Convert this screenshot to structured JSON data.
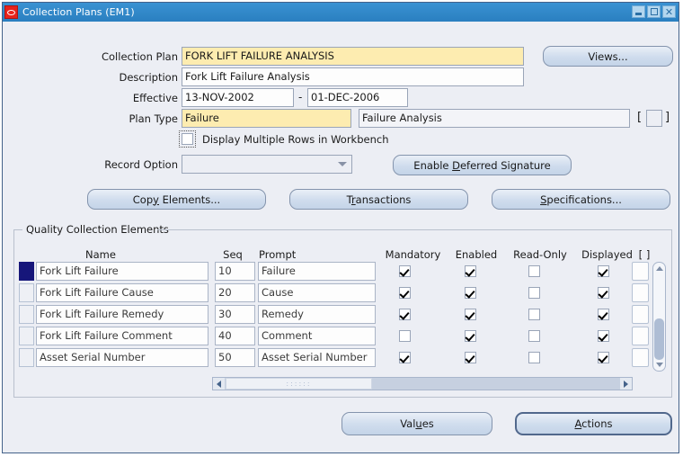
{
  "window": {
    "title": "Collection Plans (EM1)",
    "icon": "oracle-logo-icon",
    "minimize_label": "",
    "maximize_label": "",
    "close_label": "✕",
    "titlebar_color": "#2f86c8"
  },
  "form": {
    "labels": {
      "collection_plan": "Collection Plan",
      "description": "Description",
      "effective": "Effective",
      "plan_type": "Plan Type",
      "record_option": "Record Option"
    },
    "collection_plan": "FORK LIFT FAILURE ANALYSIS",
    "description": "Fork Lift Failure Analysis",
    "effective_from": "13-NOV-2002",
    "effective_dash": "-",
    "effective_to": "01-DEC-2006",
    "plan_type_code": "Failure",
    "plan_type_desc": "Failure Analysis",
    "bracket_open": "[",
    "bracket_close": "]",
    "display_multiple_rows_label": "Display Multiple Rows in Workbench",
    "display_multiple_rows_checked": false,
    "record_option_value": "",
    "required_field_color": "#fdecb0"
  },
  "buttons": {
    "views": "Views...",
    "enable_deferred_signature": "Enable Deferred Signature",
    "enable_deferred_signature_accel": "D",
    "copy_elements": "Copy Elements...",
    "copy_elements_accel": "y",
    "transactions": "Transactions",
    "transactions_accel": "r",
    "specifications": "Specifications...",
    "specifications_accel": "S",
    "values": "Values",
    "values_accel": "u",
    "actions": "Actions",
    "actions_accel": "A"
  },
  "table": {
    "group_title": "Quality Collection Elements",
    "columns": {
      "name": "Name",
      "seq": "Seq",
      "prompt": "Prompt",
      "mandatory": "Mandatory",
      "enabled": "Enabled",
      "read_only": "Read-Only",
      "displayed": "Displayed",
      "extra": "[ ]"
    },
    "rows": [
      {
        "selected": true,
        "name": "Fork Lift Failure",
        "seq": "10",
        "prompt": "Failure",
        "mandatory": true,
        "enabled": true,
        "read_only": false,
        "displayed": true
      },
      {
        "selected": false,
        "name": "Fork Lift Failure Cause",
        "seq": "20",
        "prompt": "Cause",
        "mandatory": true,
        "enabled": true,
        "read_only": false,
        "displayed": true
      },
      {
        "selected": false,
        "name": "Fork Lift Failure Remedy",
        "seq": "30",
        "prompt": "Remedy",
        "mandatory": true,
        "enabled": true,
        "read_only": false,
        "displayed": true
      },
      {
        "selected": false,
        "name": "Fork Lift Failure Comment",
        "seq": "40",
        "prompt": "Comment",
        "mandatory": false,
        "enabled": true,
        "read_only": false,
        "displayed": true
      },
      {
        "selected": false,
        "name": "Asset Serial Number",
        "seq": "50",
        "prompt": "Asset Serial Number",
        "mandatory": true,
        "enabled": true,
        "read_only": false,
        "displayed": true
      }
    ]
  }
}
